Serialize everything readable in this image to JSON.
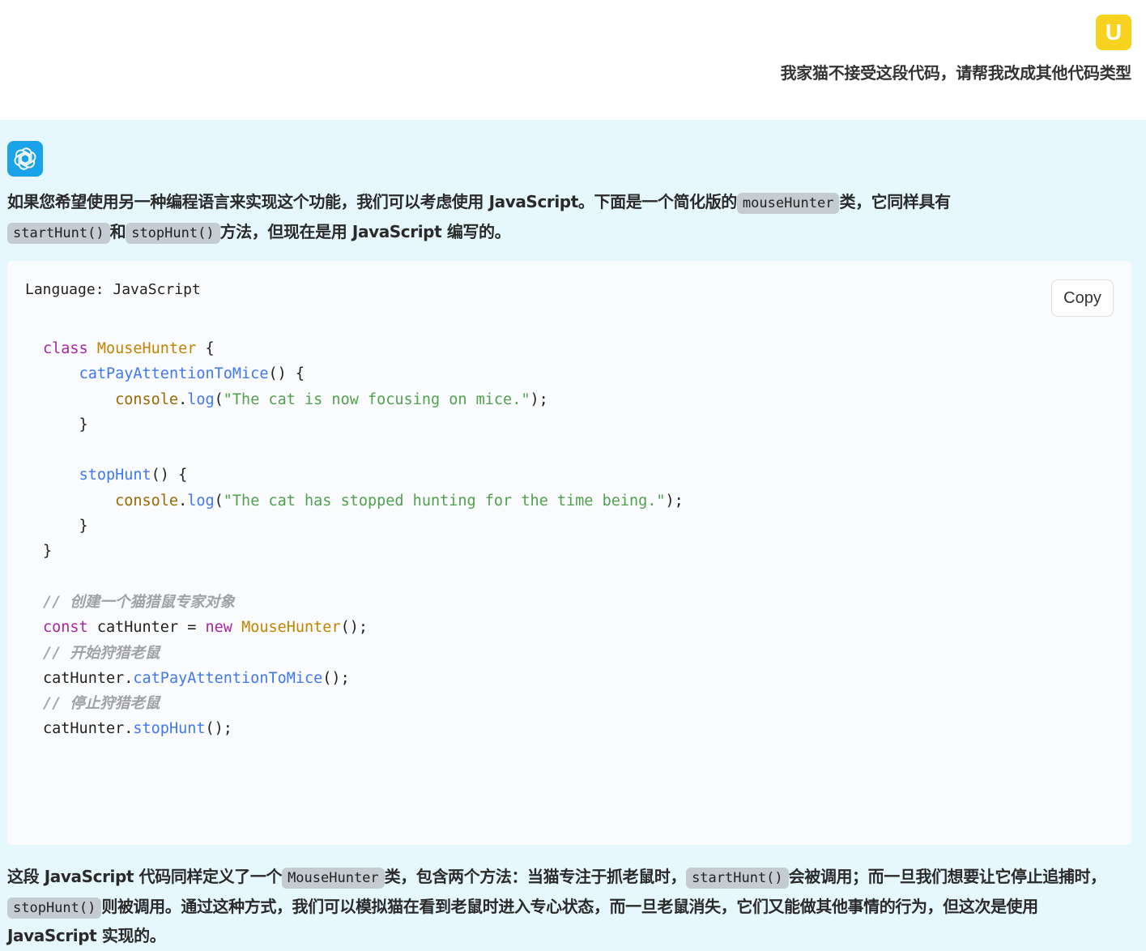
{
  "user": {
    "avatar_letter": "U",
    "message": "我家猫不接受这段代码，请帮我改成其他代码类型"
  },
  "assistant": {
    "avatar_icon": "openai-logo-icon",
    "intro": {
      "part1": "如果您希望使用另一种编程语言来实现这个功能，我们可以考虑使用 JavaScript。下面是一个简化版的",
      "code1": "mouseHunter",
      "part2": "类，它同样具有",
      "code2": "startHunt()",
      "part3": "和",
      "code3": "stopHunt()",
      "part4": "方法，但现在是用 JavaScript 编写的。"
    },
    "code_block": {
      "language_label": "Language: JavaScript",
      "copy_label": "Copy",
      "lines": [
        "class MouseHunter {",
        "    catPayAttentionToMice() {",
        "        console.log(\"The cat is now focusing on mice.\");",
        "    }",
        "",
        "    stopHunt() {",
        "        console.log(\"The cat has stopped hunting for the time being.\");",
        "    }",
        "}",
        "",
        "// 创建一个猫猎鼠专家对象",
        "const catHunter = new MouseHunter();",
        "// 开始狩猎老鼠",
        "catHunter.catPayAttentionToMice();",
        "// 停止狩猎老鼠",
        "catHunter.stopHunt();"
      ]
    },
    "outro": {
      "part1": "这段 JavaScript 代码同样定义了一个",
      "code1": "MouseHunter",
      "part2": "类，包含两个方法：当猫专注于抓老鼠时，",
      "code2": "startHunt()",
      "part3": "会被调用；而一旦我们想要让它停止追捕时，",
      "code3": "stopHunt()",
      "part4": "则被调用。通过这种方式，我们可以模拟猫在看到老鼠时进入专心状态，而一旦老鼠消失，它们又能做其他事情的行为，但这次是使用 JavaScript 实现的。"
    }
  },
  "colors": {
    "user_avatar": "#f7d21e",
    "assistant_avatar": "#1aa3e8",
    "assistant_bg": "#e6f8fd"
  }
}
